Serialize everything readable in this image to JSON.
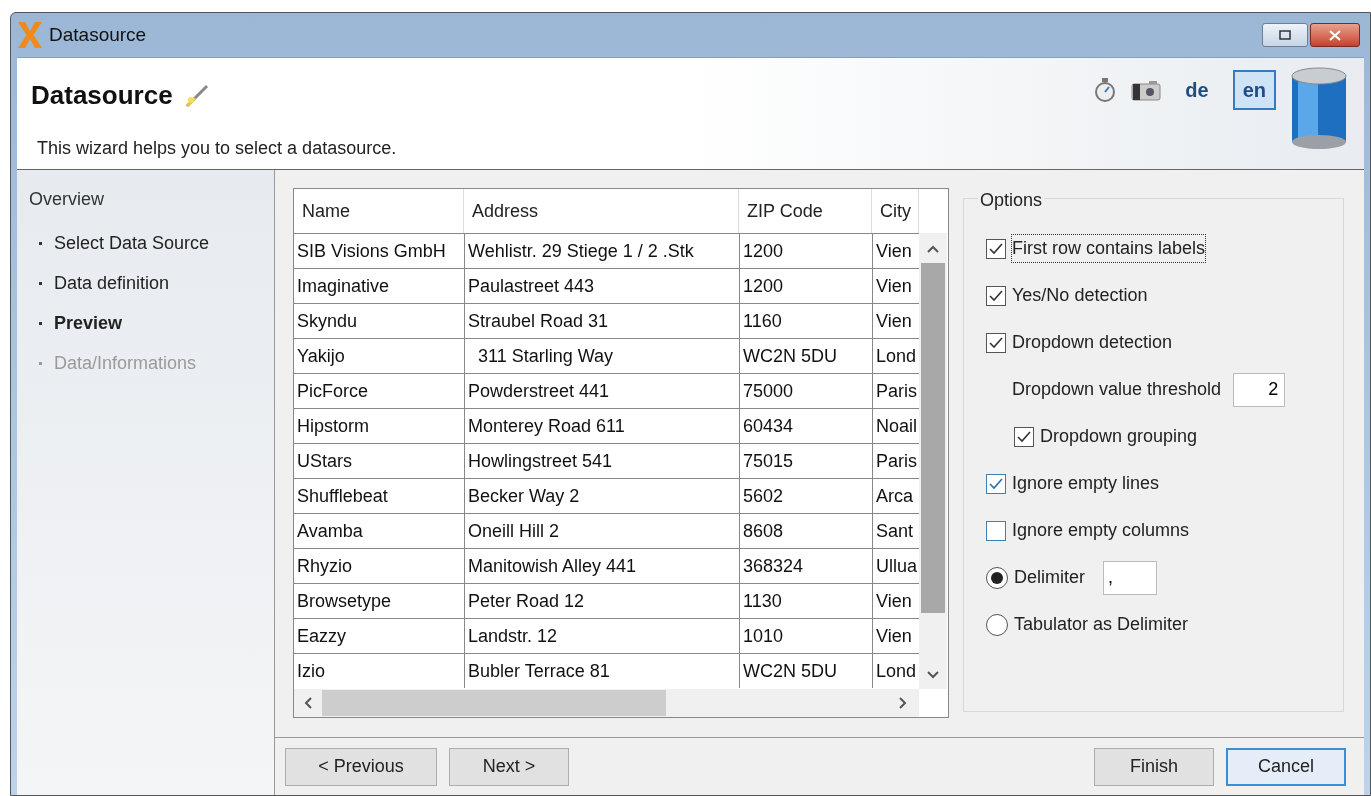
{
  "window": {
    "title": "Datasource"
  },
  "header": {
    "title": "Datasource",
    "description": "This wizard helps you to select a datasource.",
    "languages": [
      {
        "label": "de",
        "selected": false
      },
      {
        "label": "en",
        "selected": true
      }
    ]
  },
  "sidebar": {
    "title": "Overview",
    "items": [
      {
        "label": "Select Data Source",
        "selected": false,
        "disabled": false
      },
      {
        "label": "Data definition",
        "selected": false,
        "disabled": false
      },
      {
        "label": "Preview",
        "selected": true,
        "disabled": false
      },
      {
        "label": "Data/Informations",
        "selected": false,
        "disabled": true
      }
    ]
  },
  "table": {
    "columns": [
      "Name",
      "Address",
      "ZIP Code",
      "City"
    ],
    "rows": [
      [
        "SIB Visions GmbH",
        "Wehlistr. 29 Stiege 1 / 2 .Stk",
        "1200",
        "Vien"
      ],
      [
        "Imaginative",
        "Paulastreet 443",
        "1200",
        "Vien"
      ],
      [
        "Skyndu",
        "Straubel Road 31",
        "1160",
        "Vien"
      ],
      [
        "Yakijo",
        "  311 Starling Way",
        "WC2N 5DU",
        "Lond"
      ],
      [
        "PicForce",
        "Powderstreet 441",
        "75000",
        "Paris"
      ],
      [
        "Hipstorm",
        "Monterey Road 611",
        "60434",
        "Noail"
      ],
      [
        "UStars",
        "Howlingstreet 541",
        "75015",
        "Paris"
      ],
      [
        "Shufflebeat",
        "Becker Way 2",
        "5602",
        "Arca"
      ],
      [
        "Avamba",
        "Oneill Hill 2",
        "8608",
        "Sant"
      ],
      [
        "Rhyzio",
        "Manitowish Alley 441",
        "368324",
        "Ullua"
      ],
      [
        "Browsetype",
        "Peter Road 12",
        "1130",
        "Vien"
      ],
      [
        "Eazzy",
        "Landstr. 12",
        "1010",
        "Vien"
      ],
      [
        "Izio",
        "Bubler Terrace 81",
        "WC2N 5DU",
        "Lond"
      ]
    ]
  },
  "options": {
    "title": "Options",
    "items": [
      {
        "kind": "checkbox",
        "label": "First row contains labels",
        "checked": true,
        "focused": true,
        "indented": false
      },
      {
        "kind": "checkbox",
        "label": "Yes/No detection",
        "checked": true,
        "focused": false,
        "indented": false
      },
      {
        "kind": "checkbox",
        "label": "Dropdown detection",
        "checked": true,
        "focused": false,
        "indented": false
      },
      {
        "kind": "number",
        "label": "Dropdown value threshold",
        "value": "2",
        "indented": true
      },
      {
        "kind": "checkbox",
        "label": "Dropdown grouping",
        "checked": true,
        "focused": false,
        "indented": true
      },
      {
        "kind": "checkbox",
        "label": "Ignore empty lines",
        "checked": true,
        "focused": false,
        "indented": false,
        "hover": true
      },
      {
        "kind": "checkbox",
        "label": "Ignore empty columns",
        "checked": false,
        "focused": false,
        "indented": false,
        "hover": true
      },
      {
        "kind": "radio",
        "label": "Delimiter",
        "selected": true,
        "with_field": true
      },
      {
        "kind": "radio",
        "label": "Tabulator as Delimiter",
        "selected": false,
        "with_field": false
      }
    ],
    "delimiter_field": ","
  },
  "buttons": [
    {
      "label": "< Previous",
      "focused": false
    },
    {
      "label": "Next >",
      "focused": false
    },
    {
      "label": "Finish",
      "focused": false
    },
    {
      "label": "Cancel",
      "focused": true
    }
  ]
}
